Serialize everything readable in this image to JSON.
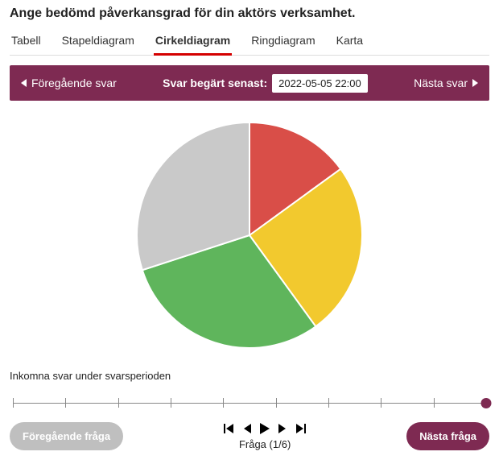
{
  "title": "Ange bedömd påverkansgrad för din aktörs verksamhet.",
  "tabs": [
    "Tabell",
    "Stapeldiagram",
    "Cirkeldiagram",
    "Ringdiagram",
    "Karta"
  ],
  "active_tab_index": 2,
  "banner": {
    "prev_label": "Föregående svar",
    "deadline_label": "Svar begärt senast:",
    "deadline_value": "2022-05-05 22:00",
    "next_label": "Nästa svar"
  },
  "chart_data": {
    "type": "pie",
    "title": "",
    "series": [
      {
        "name": "red",
        "value": 15,
        "color": "#d94e48"
      },
      {
        "name": "yellow",
        "value": 25,
        "color": "#f2c92e"
      },
      {
        "name": "green",
        "value": 30,
        "color": "#5fb55c"
      },
      {
        "name": "gray",
        "value": 30,
        "color": "#c9c9c9"
      }
    ]
  },
  "caption": "Inkomna svar under svarsperioden",
  "slider": {
    "ticks": 10,
    "position": 1.0
  },
  "player": {
    "question_label": "Fråga",
    "question_index": 1,
    "question_total": 6
  },
  "buttons": {
    "prev_question": "Föregående fråga",
    "next_question": "Nästa fråga"
  }
}
